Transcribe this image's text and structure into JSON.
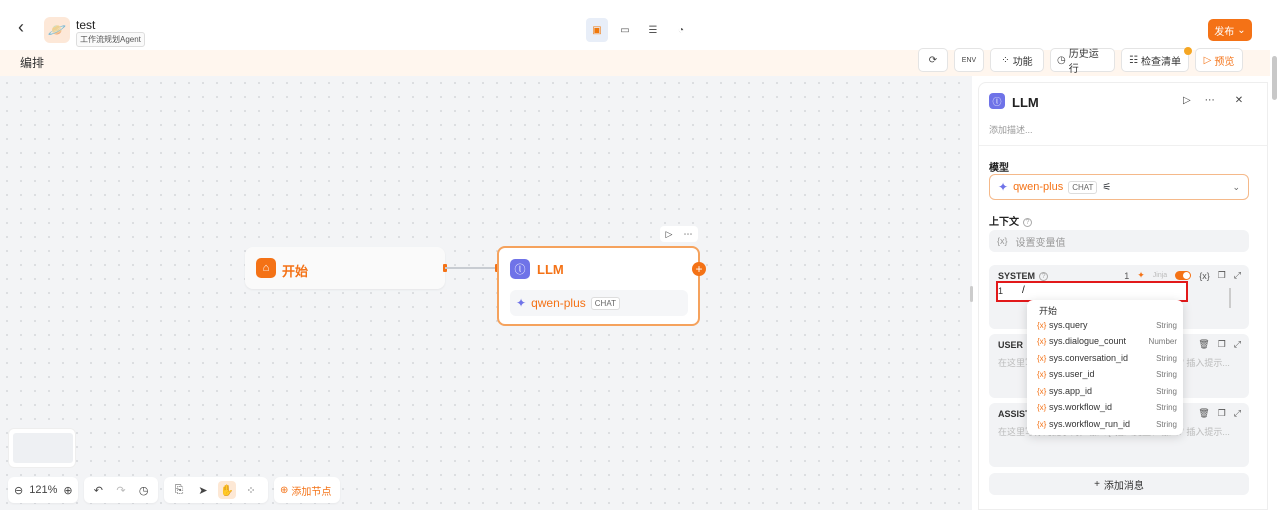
{
  "header": {
    "back_icon": "back-arrow-icon",
    "app_name": "test",
    "app_tag": "工作流规划Agent",
    "publish_label": "发布"
  },
  "subbar": {
    "title": "编排",
    "tools": [
      {
        "label": "",
        "icon": "sync-icon"
      },
      {
        "label": "",
        "icon": "env-icon"
      },
      {
        "label": "功能",
        "icon": "feature-icon"
      },
      {
        "label": "历史运行",
        "icon": "history-icon"
      },
      {
        "label": "检查清单",
        "icon": "checklist-icon"
      },
      {
        "label": "预览",
        "icon": "play-icon"
      }
    ]
  },
  "nodes": {
    "start": {
      "title": "开始"
    },
    "llm": {
      "title": "LLM",
      "model": "qwen-plus",
      "model_tag": "CHAT"
    }
  },
  "bottom": {
    "zoom": "121%",
    "add_node": "添加节点"
  },
  "panel": {
    "title": "LLM",
    "description_placeholder": "添加描述...",
    "model_label": "模型",
    "model_name": "qwen-plus",
    "model_tag": "CHAT",
    "context_label": "上下文",
    "context_placeholder": "设置变量值",
    "system": {
      "label": "SYSTEM",
      "count": "1",
      "jinja": "Jinja",
      "line_no": "1",
      "content": "/"
    },
    "user": {
      "label": "USER",
      "placeholder": "在这里写你的提示词，输入'{' 插入变量、输入'/' 插入提示..."
    },
    "assistant": {
      "label": "ASSISTANT",
      "placeholder": "在这里写你的提示词，输入'{' 插入变量、输入'/' 插入提示..."
    },
    "add_message": "添加消息"
  },
  "dropdown": {
    "header": "开始",
    "items": [
      {
        "name": "sys.query",
        "type": "String"
      },
      {
        "name": "sys.dialogue_count",
        "type": "Number"
      },
      {
        "name": "sys.conversation_id",
        "type": "String"
      },
      {
        "name": "sys.user_id",
        "type": "String"
      },
      {
        "name": "sys.app_id",
        "type": "String"
      },
      {
        "name": "sys.workflow_id",
        "type": "String"
      },
      {
        "name": "sys.workflow_run_id",
        "type": "String"
      }
    ]
  },
  "colors": {
    "accent": "#f47216",
    "highlight": "#e2191a",
    "llm_icon": "#6f73e8"
  }
}
